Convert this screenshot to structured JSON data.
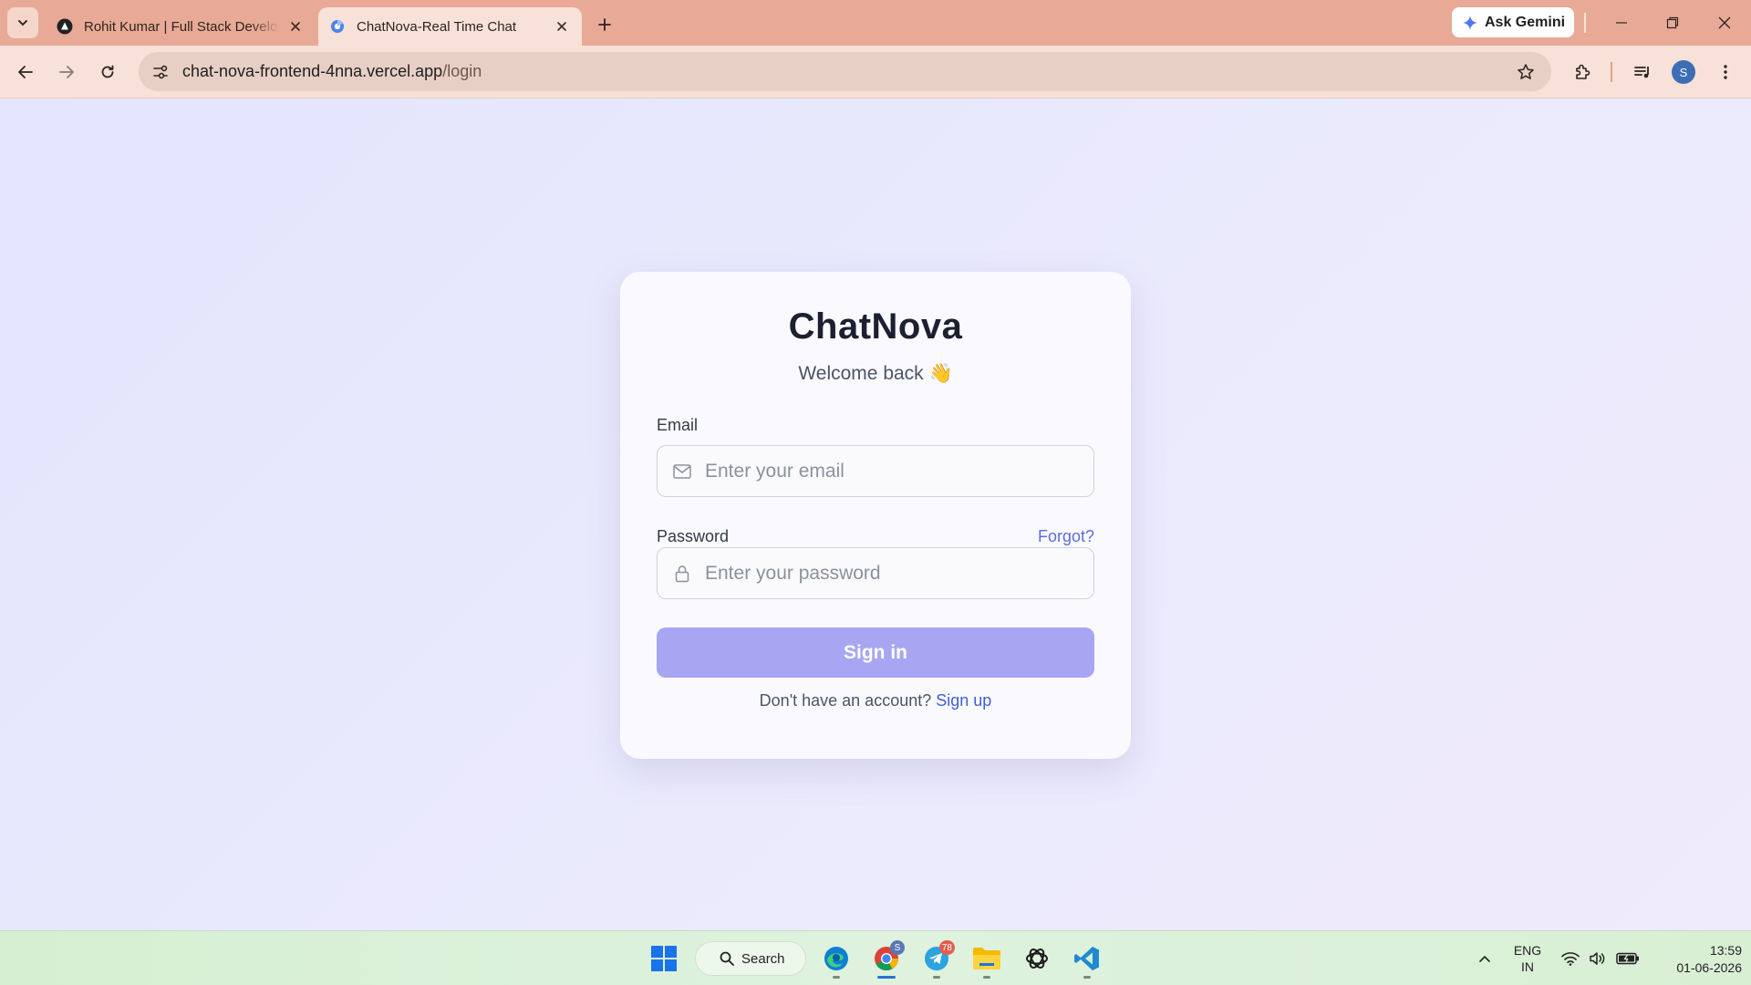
{
  "browser": {
    "tabs": [
      {
        "title": "Rohit Kumar | Full Stack Develo",
        "active": false
      },
      {
        "title": "ChatNova-Real Time Chat",
        "active": true
      }
    ],
    "ask_gemini_label": "Ask Gemini",
    "url_host": "chat-nova-frontend-4nna.vercel.app",
    "url_path": "/login",
    "profile_initial": "S"
  },
  "login": {
    "brand": "ChatNova",
    "subtitle": "Welcome back 👋",
    "email_label": "Email",
    "email_placeholder": "Enter your email",
    "password_label": "Password",
    "forgot_label": "Forgot?",
    "password_placeholder": "Enter your password",
    "signin_label": "Sign in",
    "signup_prompt": "Don't have an account?",
    "signup_link": "Sign up",
    "accent_color": "#a8a6f3",
    "link_color": "#3f5fd1"
  },
  "taskbar": {
    "search_label": "Search",
    "chrome_badge": "S",
    "telegram_badge": "78",
    "lang_line1": "ENG",
    "lang_line2": "IN",
    "time": "13:59",
    "date": "01-06-2026"
  }
}
